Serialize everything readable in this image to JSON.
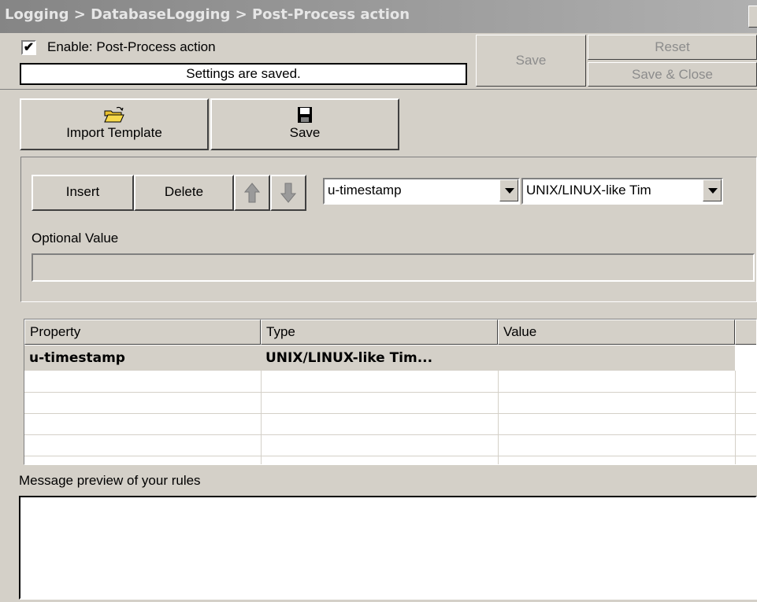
{
  "window": {
    "breadcrumb": "Logging > DatabaseLogging > Post-Process action"
  },
  "header": {
    "enable_checked": "✔",
    "enable_label": "Enable: Post-Process action",
    "status": "Settings are saved.",
    "save_label": "Save",
    "reset_label": "Reset",
    "save_close_label": "Save & Close"
  },
  "toolbar": {
    "import_label": "Import Template",
    "save_label": "Save"
  },
  "rule_editor": {
    "insert_label": "Insert",
    "delete_label": "Delete",
    "property_select": "u-timestamp",
    "type_select": "UNIX/LINUX-like Tim",
    "optional_value_label": "Optional Value",
    "optional_value": ""
  },
  "table": {
    "columns": [
      "Property",
      "Type",
      "Value"
    ],
    "rows": [
      {
        "property": "u-timestamp",
        "type": "UNIX/LINUX-like Tim...",
        "value": ""
      }
    ]
  },
  "preview": {
    "label": "Message preview of your rules",
    "text": ""
  },
  "icons": [
    "folder-open-icon",
    "floppy-disk-icon",
    "arrow-up-icon",
    "arrow-down-icon",
    "dropdown-arrow-icon"
  ]
}
